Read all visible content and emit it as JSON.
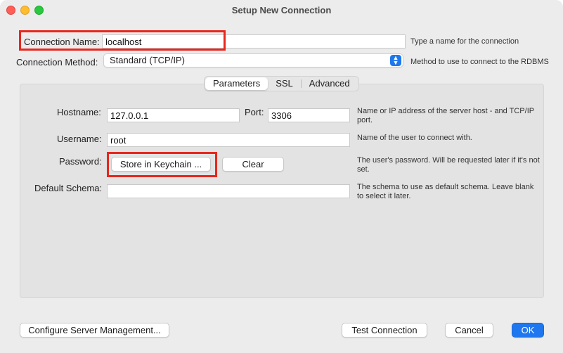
{
  "window": {
    "title": "Setup New Connection"
  },
  "connection": {
    "name_label": "Connection Name:",
    "name_value": "localhost",
    "name_hint": "Type a name for the connection",
    "method_label": "Connection Method:",
    "method_value": "Standard (TCP/IP)",
    "method_hint": "Method to use to connect to the RDBMS"
  },
  "tabs": [
    {
      "label": "Parameters",
      "active": true
    },
    {
      "label": "SSL",
      "active": false
    },
    {
      "label": "Advanced",
      "active": false
    }
  ],
  "parameters": {
    "hostname_label": "Hostname:",
    "hostname_value": "127.0.0.1",
    "port_label": "Port:",
    "port_value": "3306",
    "hostname_hint": "Name or IP address of the server host - and TCP/IP port.",
    "username_label": "Username:",
    "username_value": "root",
    "username_hint": "Name of the user to connect with.",
    "password_label": "Password:",
    "store_keychain_label": "Store in Keychain ...",
    "clear_label": "Clear",
    "password_hint": "The user's password. Will be requested later if it's not set.",
    "schema_label": "Default Schema:",
    "schema_value": "",
    "schema_hint": "The schema to use as default schema. Leave blank to select it later."
  },
  "footer": {
    "configure_label": "Configure Server Management...",
    "test_label": "Test Connection",
    "cancel_label": "Cancel",
    "ok_label": "OK"
  },
  "colors": {
    "accent": "#1f77ef",
    "highlight": "#e8271d"
  }
}
